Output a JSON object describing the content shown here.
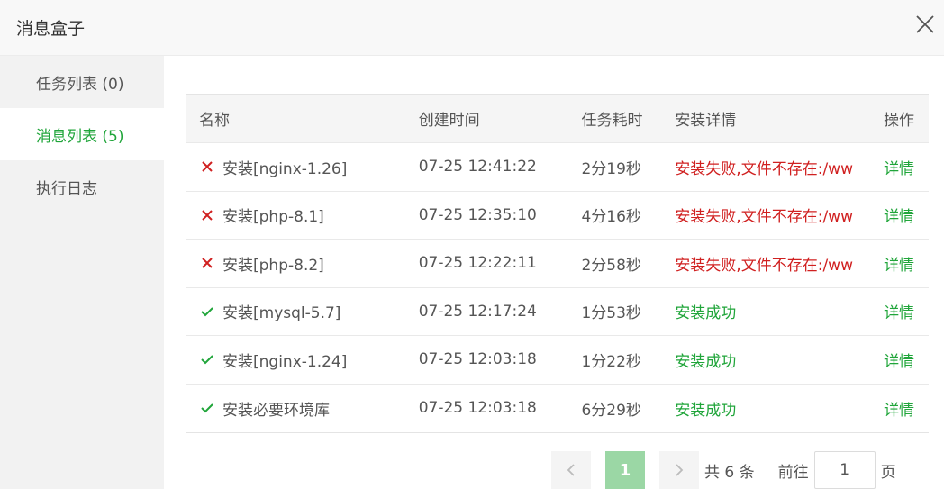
{
  "dialog": {
    "title": "消息盒子"
  },
  "sidebar": {
    "items": [
      {
        "label": "任务列表 (0)"
      },
      {
        "label": "消息列表 (5)"
      },
      {
        "label": "执行日志"
      }
    ]
  },
  "table": {
    "headers": {
      "name": "名称",
      "time": "创建时间",
      "duration": "任务耗时",
      "detail": "安装详情",
      "op": "操作"
    },
    "rows": [
      {
        "status": "fail",
        "name": "安装[nginx-1.26]",
        "time": "07-25 12:41:22",
        "duration": "2分19秒",
        "detail": "安装失败,文件不存在:/ww",
        "op": "详情"
      },
      {
        "status": "fail",
        "name": "安装[php-8.1]",
        "time": "07-25 12:35:10",
        "duration": "4分16秒",
        "detail": "安装失败,文件不存在:/ww",
        "op": "详情"
      },
      {
        "status": "fail",
        "name": "安装[php-8.2]",
        "time": "07-25 12:22:11",
        "duration": "2分58秒",
        "detail": "安装失败,文件不存在:/ww",
        "op": "详情"
      },
      {
        "status": "ok",
        "name": "安装[mysql-5.7]",
        "time": "07-25 12:17:24",
        "duration": "1分53秒",
        "detail": "安装成功",
        "op": "详情"
      },
      {
        "status": "ok",
        "name": "安装[nginx-1.24]",
        "time": "07-25 12:03:18",
        "duration": "1分22秒",
        "detail": "安装成功",
        "op": "详情"
      },
      {
        "status": "ok",
        "name": "安装必要环境库",
        "time": "07-25 12:03:18",
        "duration": "6分29秒",
        "detail": "安装成功",
        "op": "详情"
      }
    ]
  },
  "pagination": {
    "current": "1",
    "total": "共 6 条",
    "goto_label": "前往",
    "goto_value": "1",
    "page_suffix": "页"
  },
  "colors": {
    "accent": "#20a53a",
    "fail": "#d02020",
    "current_page": "#9bd7a5"
  },
  "icons": {
    "close": "close-icon",
    "fail": "cross-icon",
    "ok": "check-icon",
    "prev": "chevron-left-icon",
    "next": "chevron-right-icon"
  }
}
